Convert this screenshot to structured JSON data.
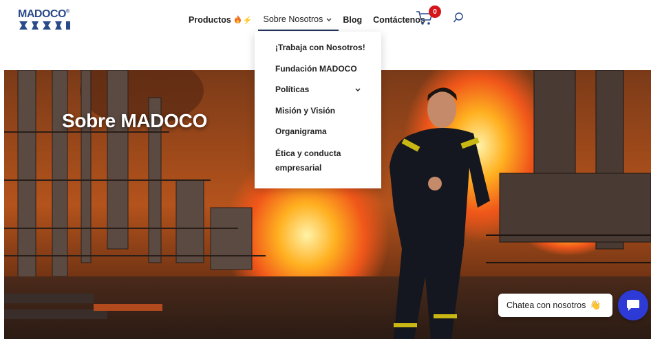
{
  "brand": {
    "name": "MADOCO",
    "registered": "®"
  },
  "nav": {
    "items": [
      {
        "label": "Productos",
        "icon": "fire-icon",
        "accent": "⚡"
      },
      {
        "label": "Sobre Nosotros",
        "icon": "chevron-down-icon"
      },
      {
        "label": "Blog"
      },
      {
        "label": "Contáctenos"
      }
    ],
    "cart_count": "0"
  },
  "dropdown": {
    "items": [
      {
        "label": "¡Trabaja con Nosotros!"
      },
      {
        "label": "Fundación MADOCO"
      },
      {
        "label": "Políticas",
        "has_submenu": true
      },
      {
        "label": "Misión y Visión"
      },
      {
        "label": "Organigrama"
      },
      {
        "label": "Ética y conducta empresarial"
      }
    ]
  },
  "hero": {
    "title": "Sobre MADOCO"
  },
  "chat": {
    "prompt": "Chatea con nosotros",
    "emoji": "👋"
  },
  "colors": {
    "brand_blue": "#2a4a8a",
    "nav_underline": "#24345e",
    "badge_red": "#d6141c",
    "chat_button": "#2d3ad6"
  }
}
